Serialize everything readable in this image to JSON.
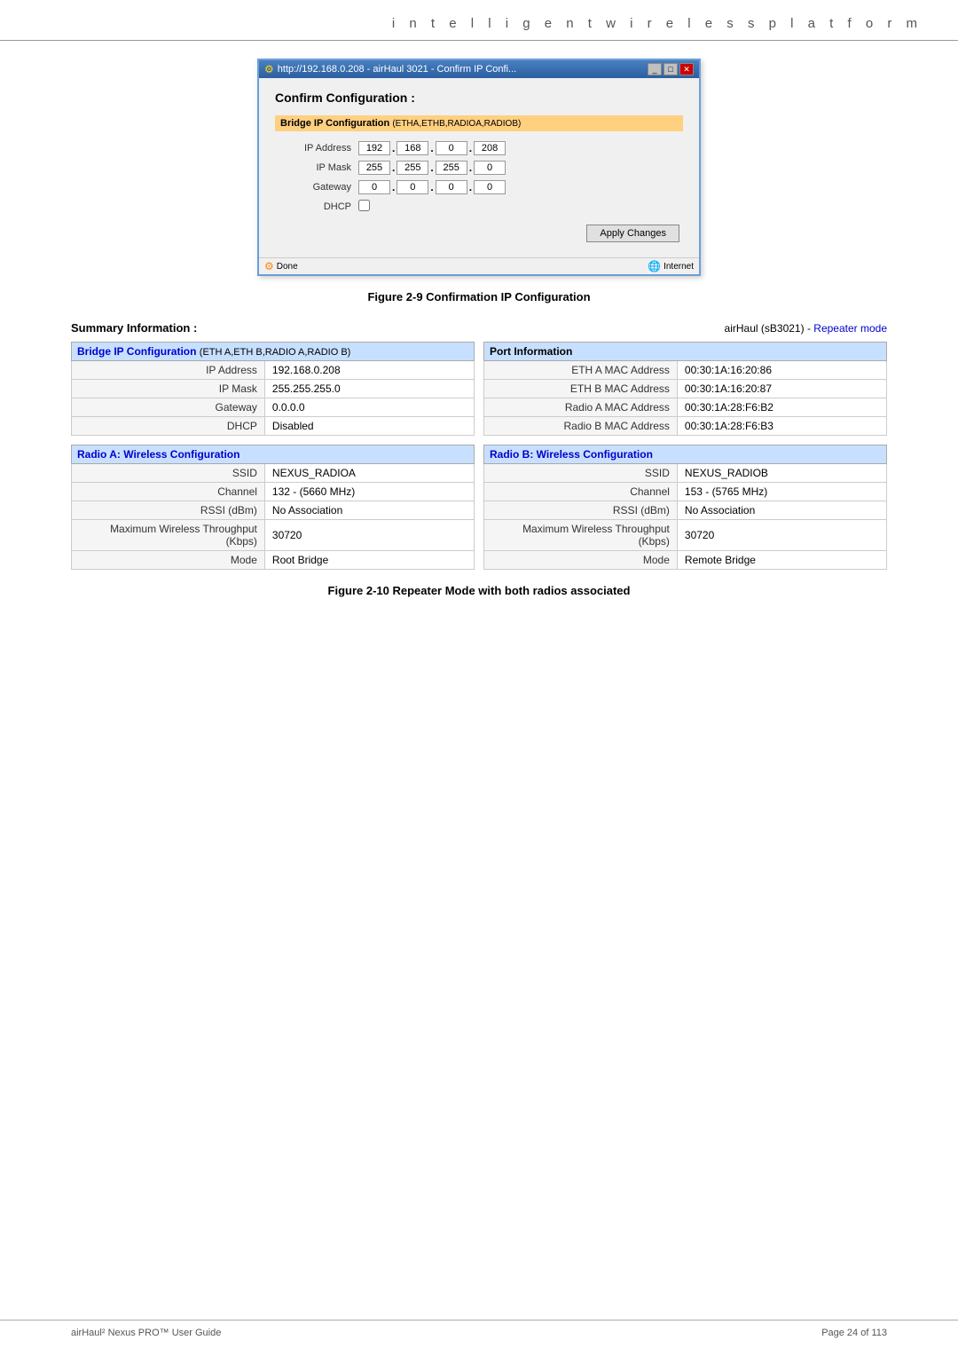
{
  "header": {
    "title": "i n t e l l i g e n t   w i r e l e s s   p l a t f o r m"
  },
  "browser": {
    "titlebar": "http://192.168.0.208 - airHaul 3021 - Confirm IP Confi...",
    "confirm_title": "Confirm Configuration :",
    "section_label": "Bridge IP Configuration",
    "section_subtitle": "(ETHA,ETHB,RADIOA,RADIOB)",
    "ip_address_label": "IP Address",
    "ip_mask_label": "IP Mask",
    "gateway_label": "Gateway",
    "dhcp_label": "DHCP",
    "ip_address": {
      "a": "192",
      "b": "168",
      "c": "0",
      "d": "208"
    },
    "ip_mask": {
      "a": "255",
      "b": "255",
      "c": "255",
      "d": "0"
    },
    "gateway": {
      "a": "0",
      "b": "0",
      "c": "0",
      "d": "0"
    },
    "apply_button": "Apply Changes",
    "status_done": "Done",
    "status_internet": "Internet",
    "btn_minimize": "_",
    "btn_maximize": "□",
    "btn_close": "✕"
  },
  "figure9": {
    "caption": "Figure 2-9 Confirmation IP Configuration"
  },
  "summary": {
    "title": "Summary Information :",
    "device": "airHaul (sB3021)",
    "mode_label": "Repeater mode",
    "bridge_section": "Bridge IP Configuration",
    "bridge_subtitle": "(ETH A,ETH B,RADIO A,RADIO B)",
    "bridge_rows": [
      {
        "label": "IP Address",
        "value": "192.168.0.208"
      },
      {
        "label": "IP Mask",
        "value": "255.255.255.0"
      },
      {
        "label": "Gateway",
        "value": "0.0.0.0"
      },
      {
        "label": "DHCP",
        "value": "Disabled"
      }
    ],
    "port_section": "Port Information",
    "port_rows": [
      {
        "label": "ETH A MAC Address",
        "value": "00:30:1A:16:20:86"
      },
      {
        "label": "ETH B MAC Address",
        "value": "00:30:1A:16:20:87"
      },
      {
        "label": "Radio A MAC Address",
        "value": "00:30:1A:28:F6:B2"
      },
      {
        "label": "Radio B MAC Address",
        "value": "00:30:1A:28:F6:B3"
      }
    ]
  },
  "radioA": {
    "section": "Radio A: Wireless Configuration",
    "rows": [
      {
        "label": "SSID",
        "value": "NEXUS_RADIOA"
      },
      {
        "label": "Channel",
        "value": "132 - (5660 MHz)"
      },
      {
        "label": "RSSI (dBm)",
        "value": "No Association"
      },
      {
        "label": "Maximum Wireless Throughput (Kbps)",
        "value": "30720"
      },
      {
        "label": "Mode",
        "value": "Root Bridge"
      }
    ]
  },
  "radioB": {
    "section": "Radio B: Wireless Configuration",
    "rows": [
      {
        "label": "SSID",
        "value": "NEXUS_RADIOB"
      },
      {
        "label": "Channel",
        "value": "153 - (5765 MHz)"
      },
      {
        "label": "RSSI (dBm)",
        "value": "No Association"
      },
      {
        "label": "Maximum Wireless Throughput (Kbps)",
        "value": "30720"
      },
      {
        "label": "Mode",
        "value": "Remote Bridge"
      }
    ]
  },
  "figure10": {
    "caption": "Figure 2-10 Repeater Mode with both radios associated"
  },
  "footer": {
    "left": "airHaul² Nexus PRO™ User Guide",
    "right": "Page 24 of 113"
  }
}
